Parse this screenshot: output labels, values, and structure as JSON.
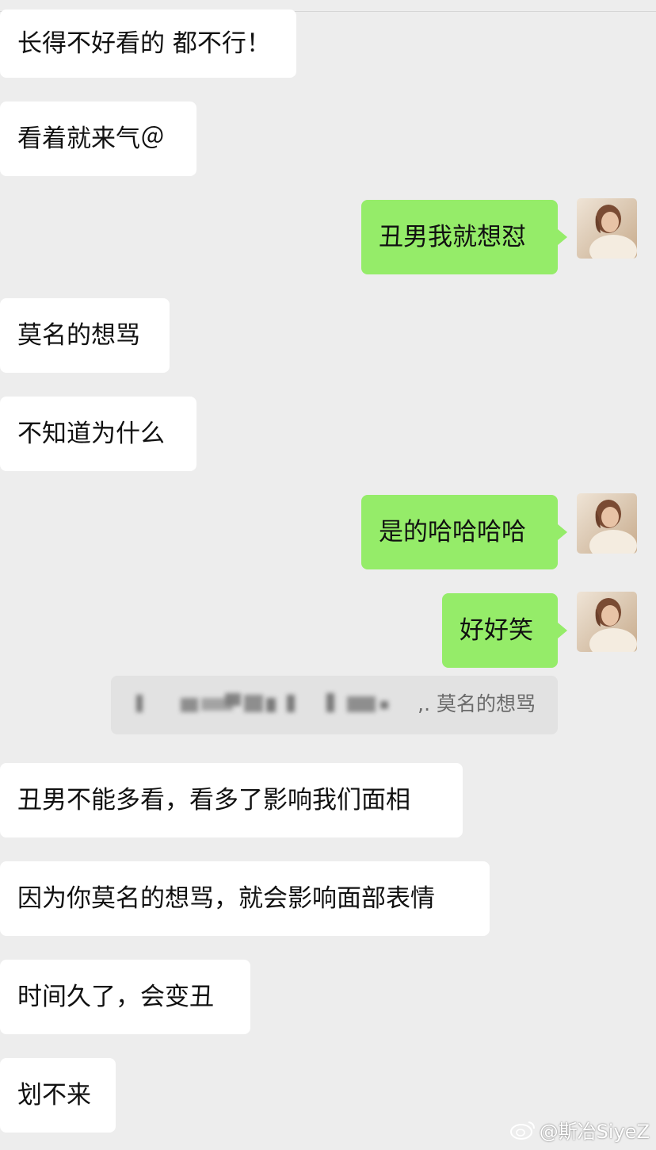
{
  "messages": [
    {
      "side": "in",
      "text": "长得不好看的 都不行！"
    },
    {
      "side": "in",
      "text": "看着就来气＠"
    },
    {
      "side": "out",
      "text": "丑男我就想怼"
    },
    {
      "side": "in",
      "text": "莫名的想骂"
    },
    {
      "side": "in",
      "text": "不知道为什么"
    },
    {
      "side": "out",
      "text": "是的哈哈哈哈"
    },
    {
      "side": "out",
      "text": "好好笑"
    },
    {
      "side": "in",
      "text": "丑男不能多看，看多了影响我们面相"
    },
    {
      "side": "in",
      "text": "因为你莫名的想骂，就会影响面部表情"
    },
    {
      "side": "in",
      "text": "时间久了，会变丑"
    },
    {
      "side": "in",
      "text": "划不来"
    }
  ],
  "quote": {
    "visible_text": ",. 莫名的想骂"
  },
  "watermark": {
    "text": "@斯冶SiyeZ",
    "icon": "weibo-icon"
  },
  "colors": {
    "background": "#EDEDED",
    "incoming": "#FFFFFF",
    "outgoing": "#95EC69"
  }
}
